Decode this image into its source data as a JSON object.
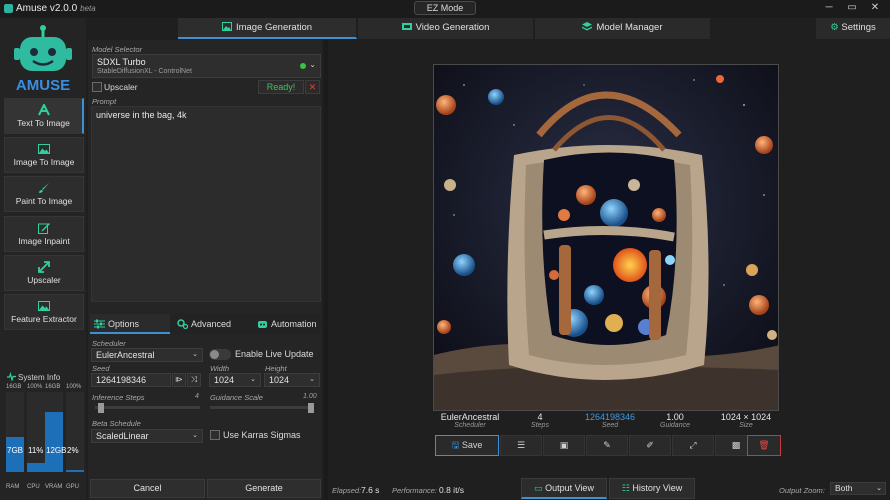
{
  "window": {
    "title": "Amuse v2.0.0",
    "title_suffix": "beta",
    "ez_mode_label": "EZ Mode"
  },
  "main_tabs": [
    {
      "label": "Image Generation",
      "icon": "image-icon"
    },
    {
      "label": "Video Generation",
      "icon": "video-icon"
    },
    {
      "label": "Model Manager",
      "icon": "layers-icon"
    }
  ],
  "settings_label": "Settings",
  "logo_text": "AMUSE",
  "nav_items": [
    {
      "label": "Text To Image",
      "icon": "text-a-icon"
    },
    {
      "label": "Image To Image",
      "icon": "image-icon"
    },
    {
      "label": "Paint To Image",
      "icon": "brush-icon"
    },
    {
      "label": "Image Inpaint",
      "icon": "edit-icon"
    },
    {
      "label": "Upscaler",
      "icon": "expand-icon"
    },
    {
      "label": "Feature Extractor",
      "icon": "image-icon"
    }
  ],
  "system_info": {
    "title": "System Info",
    "bars": [
      {
        "top": "16GB",
        "value": "7GB",
        "name": "RAM",
        "fraction": 0.44
      },
      {
        "top": "100%",
        "value": "11%",
        "name": "CPU",
        "fraction": 0.11
      },
      {
        "top": "16GB",
        "value": "12GB",
        "name": "VRAM",
        "fraction": 0.75
      },
      {
        "top": "100%",
        "value": "2%",
        "name": "GPU",
        "fraction": 0.02
      }
    ]
  },
  "model_selector": {
    "label": "Model Selector",
    "name": "SDXL Turbo",
    "subtitle": "StableDiffusionXL - ControlNet",
    "status_color": "#38c24a"
  },
  "upscaler": {
    "label": "Upscaler",
    "ready_label": "Ready!",
    "clear_label": "✕"
  },
  "prompt": {
    "label": "Prompt",
    "value": "universe in the bag, 4k"
  },
  "option_tabs": [
    {
      "label": "Options"
    },
    {
      "label": "Advanced"
    },
    {
      "label": "Automation"
    }
  ],
  "options": {
    "scheduler_label": "Scheduler",
    "scheduler_value": "EulerAncestral",
    "live_update_label": "Enable Live Update",
    "seed_label": "Seed",
    "seed_value": "1264198346",
    "width_label": "Width",
    "width_value": "1024",
    "height_label": "Height",
    "height_value": "1024",
    "inference_label": "Inference Steps",
    "inference_value": "4",
    "inference_fraction": 0.03,
    "guidance_label": "Guidance Scale",
    "guidance_value": "1.00",
    "guidance_fraction": 1.0,
    "beta_label": "Beta Schedule",
    "beta_value": "ScaledLinear",
    "karras_label": "Use Karras Sigmas"
  },
  "buttons": {
    "cancel": "Cancel",
    "generate": "Generate"
  },
  "result_meta": [
    {
      "value": "EulerAncestral",
      "key": "Scheduler"
    },
    {
      "value": "4",
      "key": "Steps"
    },
    {
      "value": "1264198346",
      "key": "Seed"
    },
    {
      "value": "1.00",
      "key": "Guidance"
    },
    {
      "value": "1024 × 1024",
      "key": "Size"
    }
  ],
  "toolbar": {
    "save_label": "Save"
  },
  "status": {
    "elapsed_label": "Elapsed:",
    "elapsed_value": "7.6 s",
    "performance_label": "Performance:",
    "performance_value": "0.8 it/s",
    "output_view_label": "Output View",
    "history_view_label": "History View",
    "zoom_label": "Output Zoom:",
    "zoom_value": "Both"
  }
}
